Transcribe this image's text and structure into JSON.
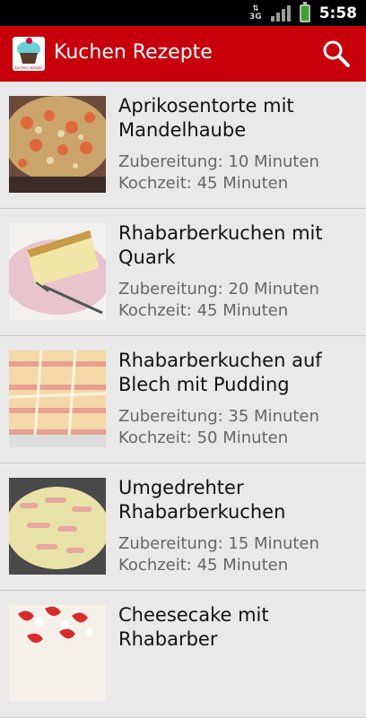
{
  "status_bar": {
    "network": "3G",
    "time": "5:58"
  },
  "app_bar": {
    "title": "Kuchen Rezepte",
    "icon_caption": "kuchen rezepte"
  },
  "recipes": [
    {
      "title_line1": "Aprikosentorte mit",
      "title_line2": "Mandelhaube",
      "prep": "Zubereitung: 10 Minuten",
      "cook": "Kochzeit: 45 Minuten"
    },
    {
      "title_line1": "Rhabarberkuchen mit",
      "title_line2": "Quark",
      "prep": "Zubereitung: 20 Minuten",
      "cook": "Kochzeit: 45 Minuten"
    },
    {
      "title_line1": "Rhabarberkuchen auf",
      "title_line2": "Blech mit Pudding",
      "prep": "Zubereitung: 35 Minuten",
      "cook": "Kochzeit: 50 Minuten"
    },
    {
      "title_line1": "Umgedrehter",
      "title_line2": "Rhabarberkuchen",
      "prep": "Zubereitung: 15 Minuten",
      "cook": "Kochzeit: 45 Minuten"
    },
    {
      "title_line1": "Cheesecake mit",
      "title_line2": "Rhabarber",
      "prep": "",
      "cook": ""
    }
  ]
}
